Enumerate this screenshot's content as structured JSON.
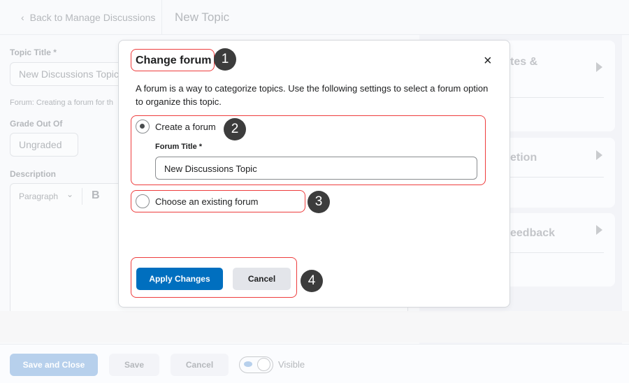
{
  "header": {
    "back_label": "Back to Manage Discussions",
    "title": "New Topic"
  },
  "form": {
    "topic_title_label": "Topic Title *",
    "topic_title_value": "New Discussions Topic",
    "forum_note": "Forum: Creating a forum for th",
    "grade_label": "Grade Out Of",
    "grade_value": "Ungraded",
    "description_label": "Description",
    "format_select": "Paragraph",
    "bold_label": "B"
  },
  "side_cards": [
    {
      "title": "tes &"
    },
    {
      "title": "etion"
    },
    {
      "title": "eedback"
    }
  ],
  "footer": {
    "save_close": "Save and Close",
    "save": "Save",
    "cancel": "Cancel",
    "visibility": "Visible"
  },
  "modal": {
    "title": "Change forum",
    "description_line1": "A forum is a way to categorize topics. Use the following settings to select a forum option",
    "description_line2": "to organize this topic.",
    "option_create": "Create a forum",
    "forum_title_label": "Forum Title *",
    "forum_title_value": "New Discussions Topic",
    "option_existing": "Choose an existing forum",
    "selected_option": "create",
    "apply": "Apply Changes",
    "cancel": "Cancel"
  },
  "annotations": [
    "1",
    "2",
    "3",
    "4"
  ],
  "colors": {
    "primary": "#006fbf",
    "annotation": "#ee3d3d"
  }
}
